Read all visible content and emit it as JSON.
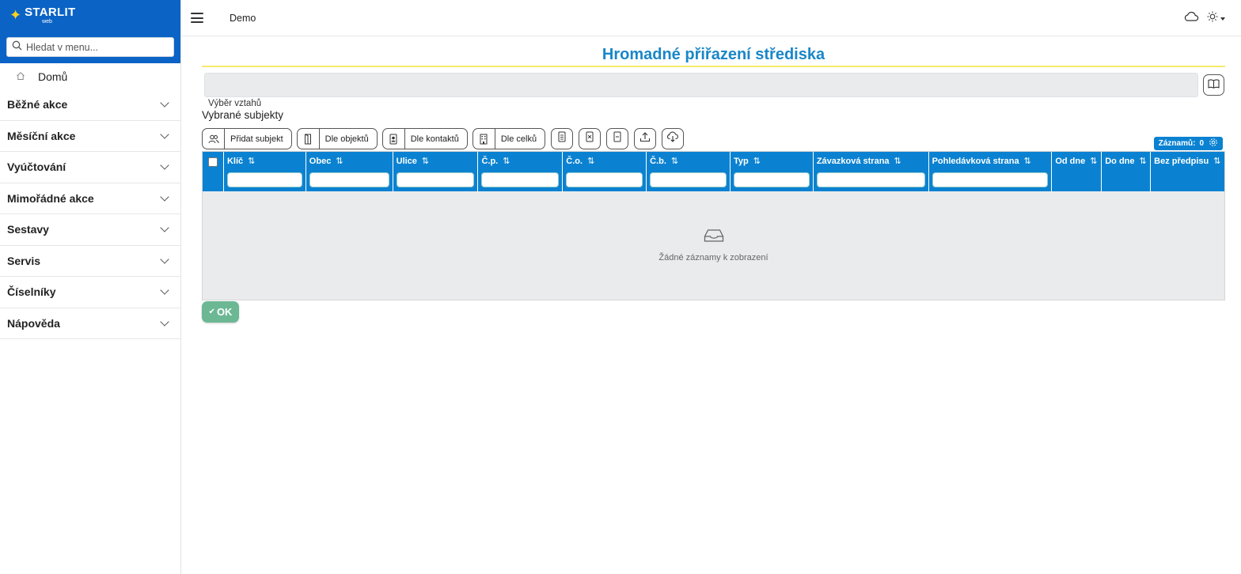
{
  "brand": {
    "name": "STARLIT",
    "sub": "web"
  },
  "sidebar": {
    "search_placeholder": "Hledat v menu...",
    "home_label": "Domů",
    "items": [
      {
        "label": "Běžné akce"
      },
      {
        "label": "Měsíční akce"
      },
      {
        "label": "Vyúčtování"
      },
      {
        "label": "Mimořádné akce"
      },
      {
        "label": "Sestavy"
      },
      {
        "label": "Servis"
      },
      {
        "label": "Číselníky"
      },
      {
        "label": "Nápověda"
      }
    ]
  },
  "header": {
    "breadcrumb": "Demo"
  },
  "main": {
    "title": "Hromadné přiřazení střediska",
    "relation_label": "Výběr vztahů",
    "section_title": "Vybrané subjekty",
    "toolbar": {
      "add_subject": "Přidat subjekt",
      "by_objects": "Dle objektů",
      "by_contacts": "Dle kontaktů",
      "by_units": "Dle celků"
    },
    "records_label": "Záznamů:",
    "records_count": "0",
    "columns": [
      "Klíč",
      "Obec",
      "Ulice",
      "Č.p.",
      "Č.o.",
      "Č.b.",
      "Typ",
      "Závazková strana",
      "Pohledávková strana",
      "Od dne",
      "Do dne",
      "Bez předpisu"
    ],
    "empty_message": "Žádné záznamy k zobrazení",
    "ok_label": "OK"
  },
  "colors": {
    "brand_blue": "#0b63c6",
    "table_header": "#0b82d1",
    "title": "#1a86c8",
    "ok": "#6cb794",
    "accent_line": "#f5ea6a"
  }
}
